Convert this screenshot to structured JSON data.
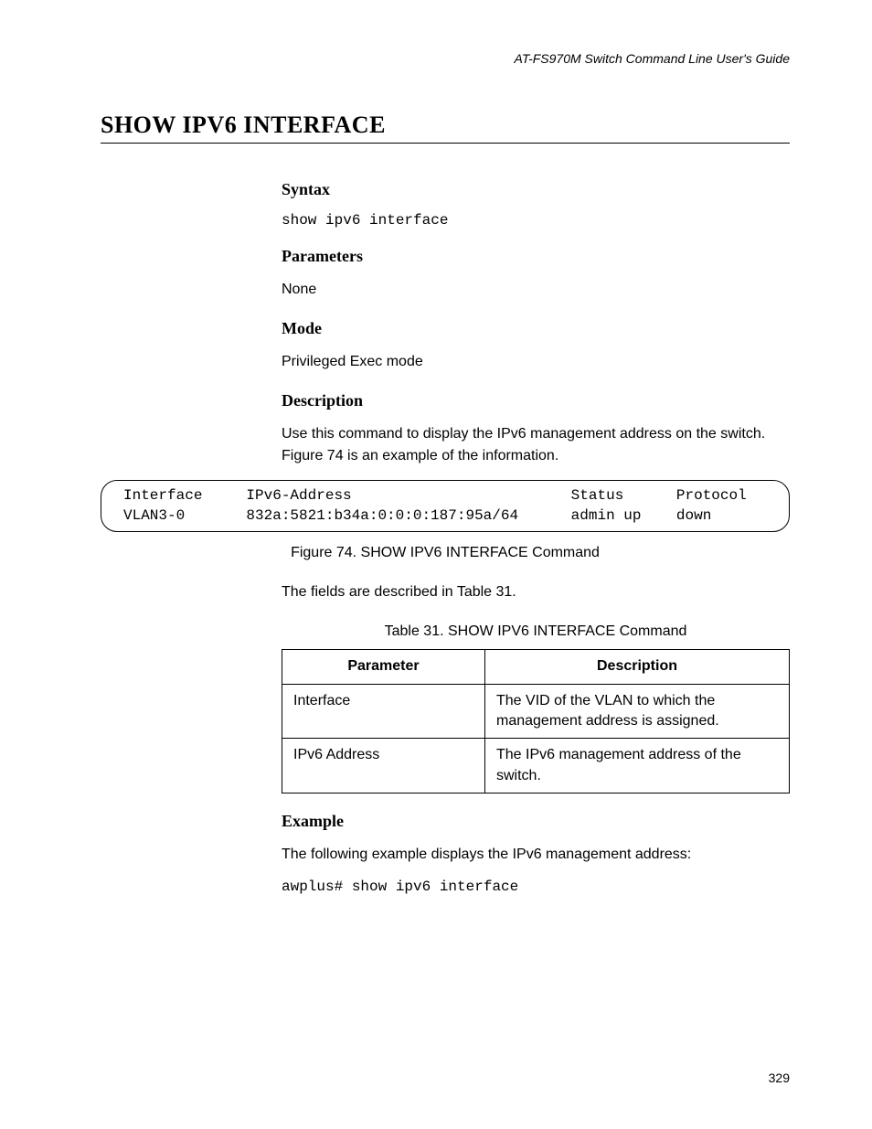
{
  "header": "AT-FS970M Switch Command Line User's Guide",
  "title": "SHOW IPV6 INTERFACE",
  "sections": {
    "syntax": {
      "heading": "Syntax",
      "command": "show ipv6 interface"
    },
    "parameters": {
      "heading": "Parameters",
      "text": "None"
    },
    "mode": {
      "heading": "Mode",
      "text": "Privileged Exec mode"
    },
    "description": {
      "heading": "Description",
      "text": "Use this command to display the IPv6 management address on the switch. Figure 74 is an example of the information."
    },
    "figure": {
      "content": "Interface     IPv6-Address                         Status      Protocol\nVLAN3-0       832a:5821:b34a:0:0:0:187:95a/64      admin up    down",
      "caption": "Figure 74. SHOW IPV6 INTERFACE Command"
    },
    "postfigure": "The fields are described in Table 31.",
    "table": {
      "caption": "Table 31. SHOW IPV6 INTERFACE Command",
      "headers": {
        "param": "Parameter",
        "desc": "Description"
      },
      "rows": [
        {
          "param": "Interface",
          "desc": "The VID of the VLAN to which the management address is assigned."
        },
        {
          "param": "IPv6 Address",
          "desc": "The IPv6 management address of the switch."
        }
      ]
    },
    "example": {
      "heading": "Example",
      "text": "The following example displays the IPv6 management address:",
      "command": "awplus# show ipv6 interface"
    }
  },
  "pageNumber": "329"
}
